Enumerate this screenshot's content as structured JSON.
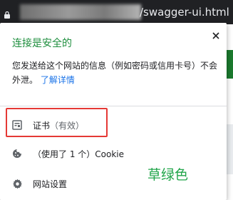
{
  "address_bar": {
    "url_suffix": "/swagger-ui.html",
    "lock_icon": "lock-icon"
  },
  "popup": {
    "title": "连接是安全的",
    "description_text": "您发送给这个网站的信息（例如密码或信用卡号）不会外泄。",
    "learn_more": "了解详情",
    "close_icon": "close-icon",
    "items": [
      {
        "label": "证书",
        "sub": "（有效）",
        "icon": "certificate-icon"
      },
      {
        "label": "（使用了 1 个）Cookie",
        "icon": "cookie-icon"
      },
      {
        "label": "网站设置",
        "icon": "gear-icon"
      }
    ]
  },
  "annotation": {
    "text": "草绿色",
    "color": "#21a54a",
    "highlight_color": "#e53935"
  },
  "colors": {
    "title_green": "#1e8e3e",
    "link_blue": "#1a73e8",
    "addressbar_bg": "#202124"
  }
}
